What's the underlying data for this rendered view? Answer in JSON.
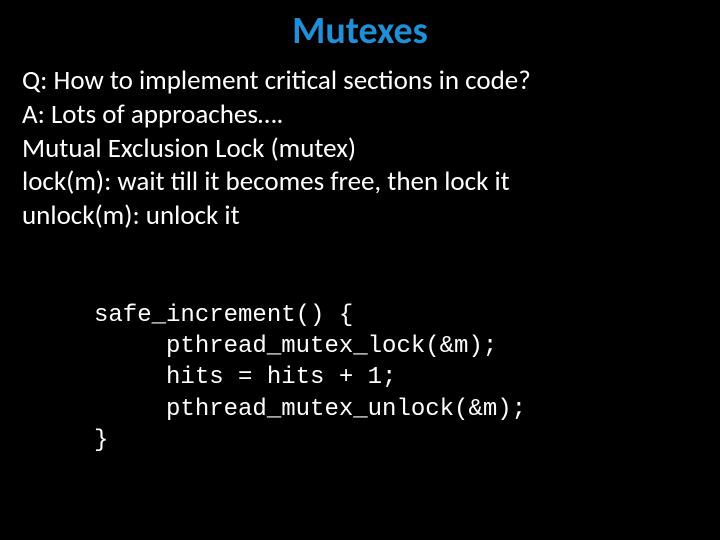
{
  "title": "Mutexes",
  "body": {
    "line1": "Q: How to implement critical sections in code?",
    "line2": "A: Lots of approaches….",
    "line3": "Mutual Exclusion Lock (mutex)",
    "line4": "lock(m): wait till it becomes free, then lock it",
    "line5": "unlock(m): unlock it"
  },
  "code": {
    "line1": "safe_increment() {",
    "line2": "     pthread_mutex_lock(&m);",
    "line3": "     hits = hits + 1;",
    "line4": "     pthread_mutex_unlock(&m);",
    "line5": "}"
  }
}
